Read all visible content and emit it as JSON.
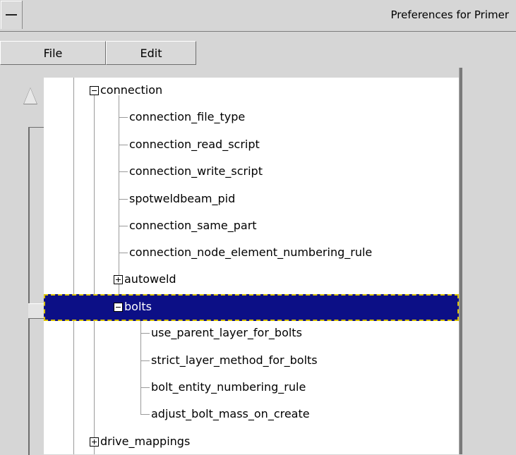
{
  "window": {
    "title": "Preferences for Primer",
    "system_menu_icon": "dash-icon"
  },
  "menubar": {
    "file_label": "File",
    "edit_label": "Edit"
  },
  "tree": {
    "selected_color": "#0c0f86",
    "nodes": [
      {
        "label": "connection",
        "expander": "minus"
      },
      {
        "label": "connection_file_type"
      },
      {
        "label": "connection_read_script"
      },
      {
        "label": "connection_write_script"
      },
      {
        "label": "spotweldbeam_pid"
      },
      {
        "label": "connection_same_part"
      },
      {
        "label": "connection_node_element_numbering_rule"
      },
      {
        "label": "autoweld",
        "expander": "plus"
      },
      {
        "label": "bolts",
        "expander": "minus",
        "selected": true
      },
      {
        "label": "use_parent_layer_for_bolts"
      },
      {
        "label": "strict_layer_method_for_bolts"
      },
      {
        "label": "bolt_entity_numbering_rule"
      },
      {
        "label": "adjust_bolt_mass_on_create"
      },
      {
        "label": "drive_mappings",
        "expander": "plus"
      }
    ]
  }
}
